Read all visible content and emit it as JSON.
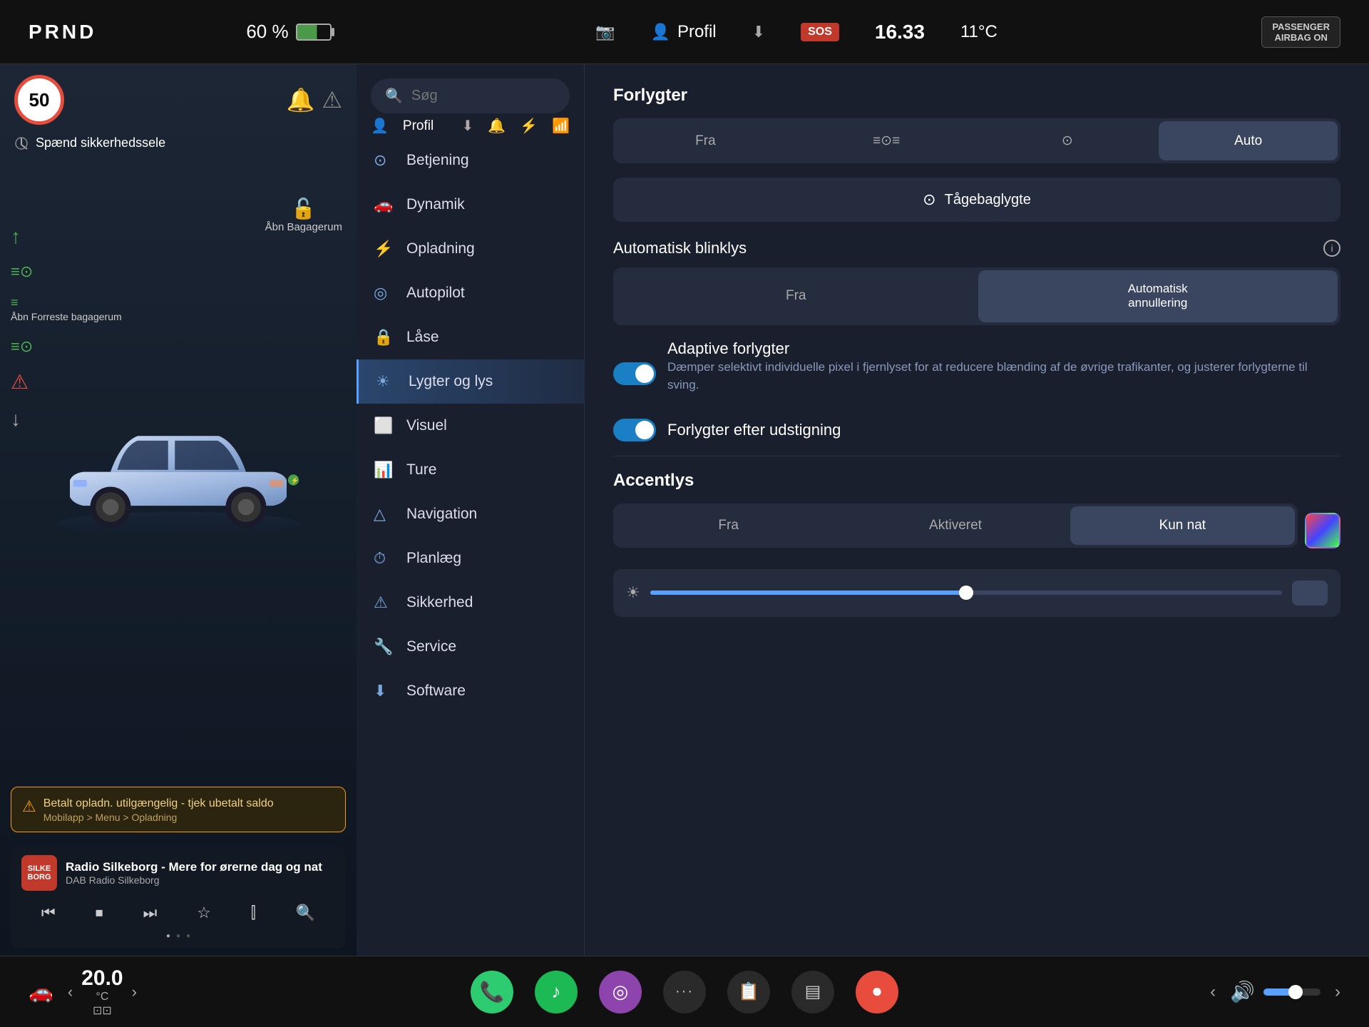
{
  "topbar": {
    "prnd": "PRND",
    "battery_pct": "60 %",
    "profile": "Profil",
    "sos": "SOS",
    "time": "16.33",
    "temp": "11°C",
    "airbag": "PASSENGER\nAIRBAG ON"
  },
  "left_panel": {
    "speed_limit": "50",
    "seatbelt_warning": "Spænd sikkerhedssele",
    "baggage_open": "Åbn\nBagagerum",
    "front_baggage": "Åbn\nForreste\nbagagerum",
    "charge_warning": {
      "title": "Betalt opladn. utilgængelig - tjek ubetalt saldo",
      "sub": "Mobilapp > Menu > Opladning"
    },
    "radio": {
      "title": "Radio Silkeborg - Mere for ørerne dag og nat",
      "sub": "DAB Radio Silkeborg",
      "logo": "SILKEBORG"
    }
  },
  "menu": {
    "search_placeholder": "Søg",
    "profile_label": "Profil",
    "items": [
      {
        "id": "betjening",
        "icon": "⊙",
        "label": "Betjening"
      },
      {
        "id": "dynamik",
        "icon": "🚗",
        "label": "Dynamik"
      },
      {
        "id": "opladning",
        "icon": "⚡",
        "label": "Opladning"
      },
      {
        "id": "autopilot",
        "icon": "◎",
        "label": "Autopilot"
      },
      {
        "id": "lase",
        "icon": "🔒",
        "label": "Låse"
      },
      {
        "id": "lygter",
        "icon": "☀",
        "label": "Lygter og lys",
        "active": true
      },
      {
        "id": "visuel",
        "icon": "⬜",
        "label": "Visuel"
      },
      {
        "id": "ture",
        "icon": "📊",
        "label": "Ture"
      },
      {
        "id": "navigation",
        "icon": "△",
        "label": "Navigation"
      },
      {
        "id": "planlaeg",
        "icon": "⏱",
        "label": "Planlæg"
      },
      {
        "id": "sikkerhed",
        "icon": "⚠",
        "label": "Sikkerhed"
      },
      {
        "id": "service",
        "icon": "🔧",
        "label": "Service"
      },
      {
        "id": "software",
        "icon": "⬇",
        "label": "Software"
      }
    ]
  },
  "settings": {
    "forlygter": {
      "title": "Forlygter",
      "options": [
        "Fra",
        "≡◎≡",
        "⊙",
        "Auto"
      ],
      "active": "Auto"
    },
    "foglight": {
      "label": "Tågebaglygte",
      "icon": "⊙"
    },
    "auto_blink": {
      "title": "Automatisk blinklys",
      "options": [
        "Fra",
        "Automatisk\nannullering"
      ],
      "active": "Automatisk annullering"
    },
    "adaptive": {
      "label": "Adaptive forlygter",
      "enabled": true,
      "description": "Dæmper selektivt individuelle pixel i fjernlyset for at\nreducere blænding af de øvrige trafikanter, og\njusterer forlygterne til sving."
    },
    "exit_lights": {
      "label": "Forlygter efter udstigning",
      "enabled": true
    },
    "accentlys": {
      "title": "Accentlys",
      "options": [
        "Fra",
        "Aktiveret",
        "Kun nat"
      ],
      "active": "Kun nat"
    }
  },
  "taskbar": {
    "temp_value": "20.0",
    "temp_label": "°C",
    "icons": [
      {
        "id": "phone",
        "icon": "📞",
        "color": "phone"
      },
      {
        "id": "spotify",
        "icon": "♪",
        "color": "spotify"
      },
      {
        "id": "purple-app",
        "icon": "◎",
        "color": "purple"
      },
      {
        "id": "dots",
        "icon": "···",
        "color": "dark"
      },
      {
        "id": "notes",
        "icon": "📋",
        "color": "dark"
      },
      {
        "id": "card",
        "icon": "▤",
        "color": "dark"
      },
      {
        "id": "record",
        "icon": "⏺",
        "color": "red"
      }
    ],
    "volume_icon": "🔊",
    "volume_level": "medium"
  }
}
